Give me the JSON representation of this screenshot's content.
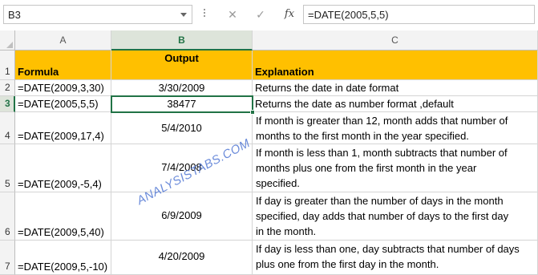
{
  "formula_bar": {
    "name_box": "B3",
    "cancel_glyph": "✕",
    "enter_glyph": "✓",
    "fx_label": "fx",
    "formula": "=DATE(2005,5,5)"
  },
  "columns": [
    "A",
    "B",
    "C"
  ],
  "rows": [
    "1",
    "2",
    "3",
    "4",
    "5",
    "6",
    "7"
  ],
  "table": {
    "header": {
      "formula": "Formula",
      "output": "Output",
      "explanation": "Explanation"
    },
    "rows": [
      {
        "formula": "=DATE(2009,3,30)",
        "output": "3/30/2009",
        "explanation": [
          "Returns the date in date format"
        ]
      },
      {
        "formula": "=DATE(2005,5,5)",
        "output": "38477",
        "explanation": [
          "Returns the date as number format ,default"
        ]
      },
      {
        "formula": "=DATE(2009,17,4)",
        "output": "5/4/2010",
        "explanation": [
          "If month is greater than 12, month adds that number of",
          "months to the first month in the year specified."
        ]
      },
      {
        "formula": "=DATE(2009,-5,4)",
        "output": "7/4/2008",
        "explanation": [
          "If month is less than 1, month subtracts that number of",
          "months plus one from the first month in the year",
          "specified."
        ]
      },
      {
        "formula": "=DATE(2009,5,40)",
        "output": "6/9/2009",
        "explanation": [
          "If day is greater than the number of days in the  month",
          "specified, day adds that number of days to the first day",
          "in the month."
        ]
      },
      {
        "formula": "=DATE(2009,5,-10)",
        "output": "4/20/2009",
        "explanation": [
          "If day is less than one, day subtracts that number of days",
          "plus one from the first day in the month."
        ]
      }
    ]
  },
  "watermark": "ANALYSISTABS.COM",
  "colors": {
    "header_fill": "#ffc000",
    "selection": "#217346",
    "watermark": "#5b7fd6"
  }
}
